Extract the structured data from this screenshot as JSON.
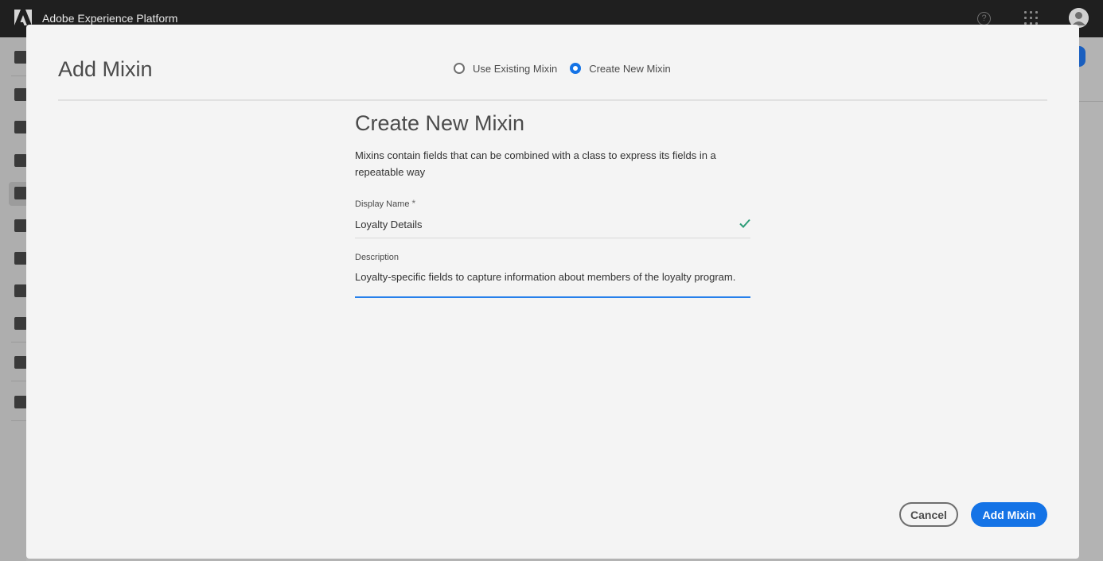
{
  "topbar": {
    "app_title": "Adobe Experience Platform",
    "help_icon": "help-icon",
    "apps_icon": "apps-grid-icon",
    "avatar_icon": "user-avatar-icon",
    "background": "#1f1f1f"
  },
  "sidebar": {
    "icons": [
      "home-icon",
      "profile-icon",
      "segments-icon",
      "identities-icon",
      "schemas-icon",
      "datasets-icon",
      "sources-icon",
      "models-icon",
      "queries-icon",
      "destinations-icon",
      "monitoring-icon"
    ]
  },
  "modal": {
    "title": "Add Mixin",
    "mode_options": [
      {
        "label": "Use Existing Mixin",
        "selected": false
      },
      {
        "label": "Create New Mixin",
        "selected": true
      }
    ],
    "section_title": "Create New Mixin",
    "section_description": "Mixins contain fields that can be combined with a class to express its fields in a repeatable way",
    "display_name": {
      "label": "Display Name",
      "required_marker": "*",
      "value": "Loyalty Details",
      "valid": true
    },
    "description": {
      "label": "Description",
      "value": "Loyalty-specific fields to capture information about members of the loyalty program."
    },
    "buttons": {
      "cancel": "Cancel",
      "submit": "Add Mixin"
    }
  },
  "colors": {
    "accent": "#1473e6",
    "valid": "#2d9d78",
    "modal_background": "#f4f4f4"
  }
}
